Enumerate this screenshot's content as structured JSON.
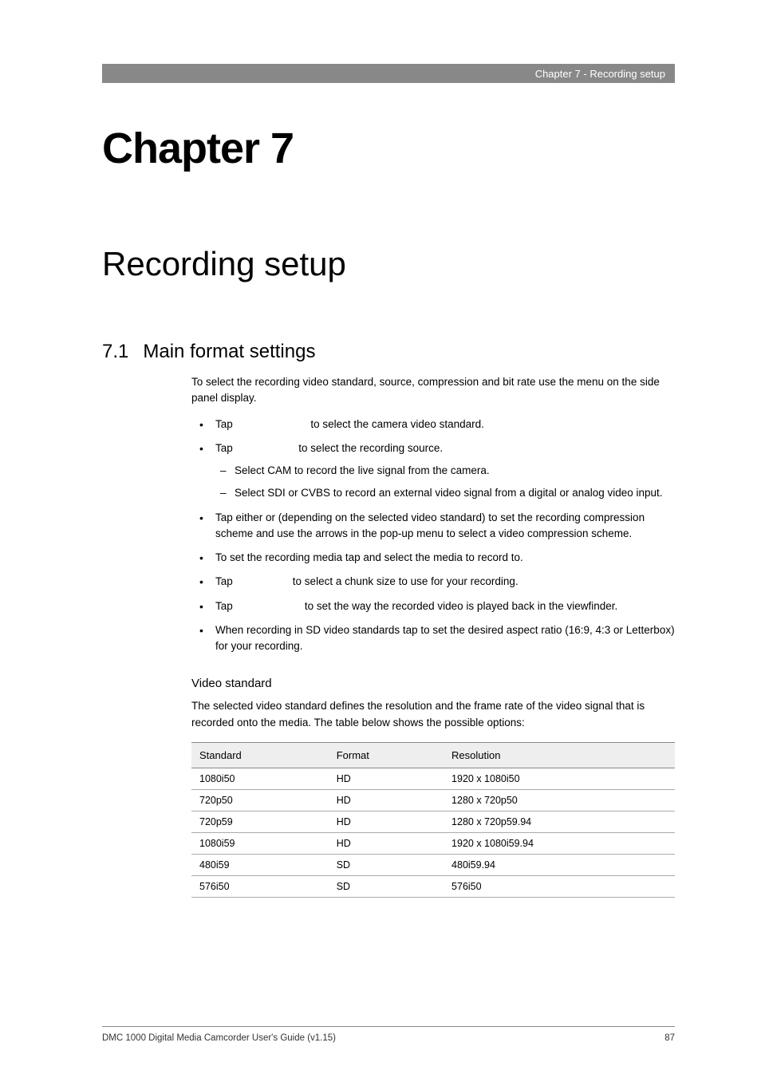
{
  "header": {
    "running_title": "Chapter 7 - Recording setup"
  },
  "chapter": {
    "number": "Chapter 7",
    "title": "Recording setup"
  },
  "section": {
    "number": "7.1",
    "title": "Main format settings",
    "intro": "To select the recording video standard, source, compression and bit rate use the menu on the side panel display.",
    "bullets": [
      {
        "prefix": "Tap ",
        "suffix": " to select the camera video standard."
      },
      {
        "prefix": "Tap ",
        "suffix": " to select the recording source.",
        "sub": [
          "Select CAM to record the live signal from the camera.",
          "Select SDI or CVBS to record an external video signal from a digital or analog video input."
        ]
      },
      {
        "text": "Tap either                                   or                                 (depending on the selected video standard) to set the recording compression scheme and use the arrows in the pop-up menu to select a video compression scheme."
      },
      {
        "text": "To set the recording media tap                                      and select the media to record to."
      },
      {
        "prefix": "Tap ",
        "suffix": " to select a chunk size to use for your recording."
      },
      {
        "prefix": "Tap ",
        "suffix": " to set the way the recorded video is played back in the viewfinder."
      },
      {
        "text": "When recording in SD video standards tap                             to set the desired aspect ratio (16:9, 4:3 or Letterbox) for your recording."
      }
    ]
  },
  "subsection": {
    "title": "Video standard",
    "text": "The selected video standard defines the resolution and the frame rate of the video signal that is recorded onto the media. The table below shows the possible options:"
  },
  "table": {
    "headers": [
      "Standard",
      "Format",
      "Resolution"
    ],
    "rows": [
      [
        "1080i50",
        "HD",
        "1920 x 1080i50"
      ],
      [
        "720p50",
        "HD",
        "1280 x 720p50"
      ],
      [
        "720p59",
        "HD",
        "1280 x 720p59.94"
      ],
      [
        "1080i59",
        "HD",
        "1920 x 1080i59.94"
      ],
      [
        "480i59",
        "SD",
        "480i59.94"
      ],
      [
        "576i50",
        "SD",
        "576i50"
      ]
    ]
  },
  "footer": {
    "left": "DMC 1000 Digital Media Camcorder User's Guide (v1.15)",
    "right": "87"
  }
}
